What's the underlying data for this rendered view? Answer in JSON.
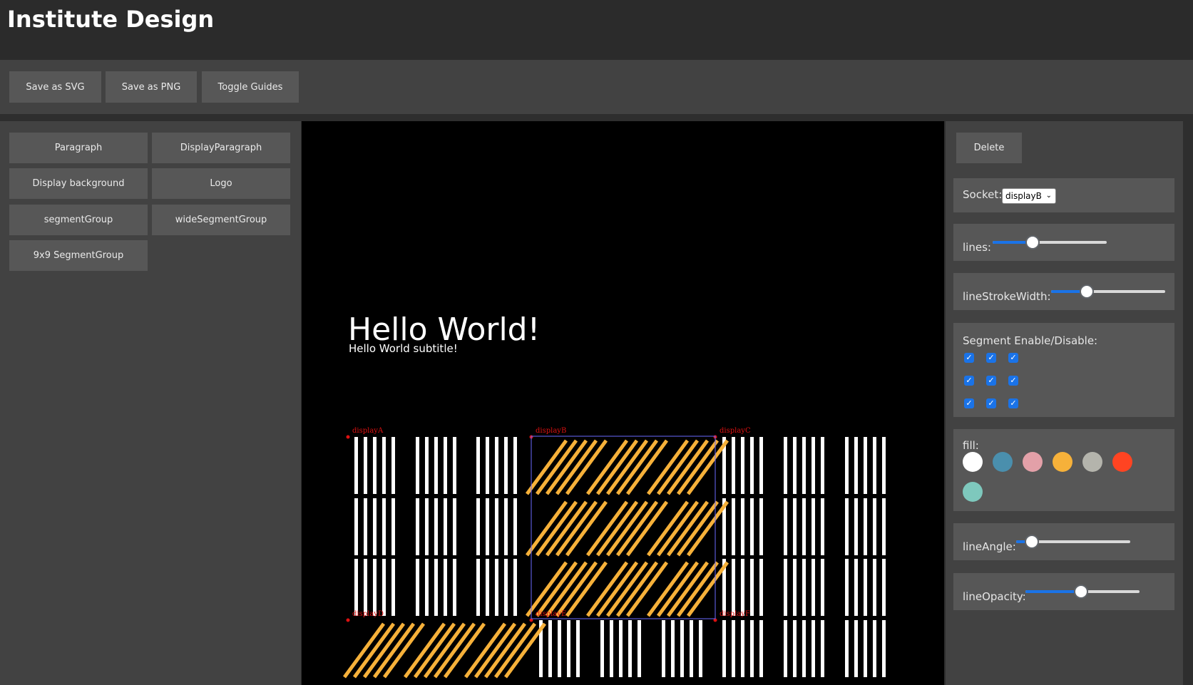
{
  "app": {
    "title": "Institute Design"
  },
  "toolbar": {
    "save_svg": "Save as SVG",
    "save_png": "Save as PNG",
    "toggle_guides": "Toggle Guides"
  },
  "components": [
    "Paragraph",
    "DisplayParagraph",
    "Display background",
    "Logo",
    "segmentGroup",
    "wideSegmentGroup",
    "9x9 SegmentGroup"
  ],
  "canvas": {
    "heading": "Hello World!",
    "subtitle": "Hello World subtitle!",
    "socket_labels": [
      "displayA",
      "displayB",
      "displayC",
      "displayD",
      "displayE",
      "displayF"
    ],
    "stripe_color": "#ffffff",
    "segment_color": "#f6b13a",
    "guide_color": "#dd1111",
    "selection_color": "#6a6aff"
  },
  "inspector": {
    "delete": "Delete",
    "socket_label": "Socket:",
    "socket_value": "displayB",
    "lines_label": "lines:",
    "lines_value": 0.35,
    "stroke_label": "lineStrokeWidth:",
    "stroke_value": 0.31,
    "segments_label": "Segment Enable/Disable:",
    "segments": [
      [
        true,
        true,
        true
      ],
      [
        true,
        true,
        true
      ],
      [
        true,
        true,
        true
      ]
    ],
    "fill_label": "fill:",
    "fill_colors": [
      "#ffffff",
      "#4a8fad",
      "#e3a0a8",
      "#f6b13a",
      "#b4b4ac",
      "#ff4422",
      "#7ec8bd"
    ],
    "angle_label": "lineAngle:",
    "angle_value": 0.14,
    "opacity_label": "lineOpacity:",
    "opacity_value": 0.49
  }
}
